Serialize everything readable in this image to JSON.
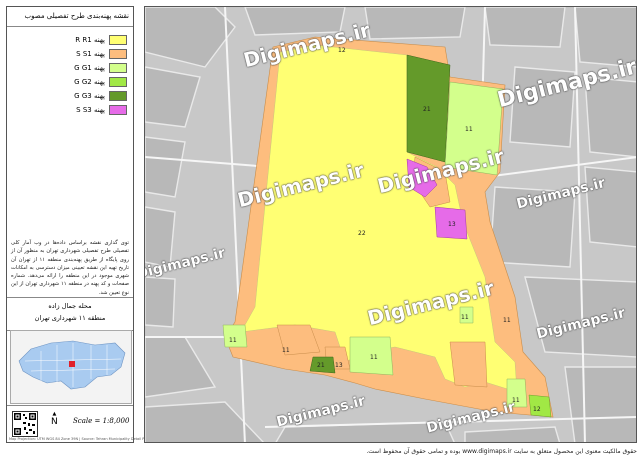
{
  "legend": {
    "title": "نقشه پهنه‌بندی طرح تفصیلی مصوب",
    "items": [
      {
        "label": "پهنه R",
        "code": "R1",
        "color": "#ffff73"
      },
      {
        "label": "پهنه S",
        "code": "S1",
        "color": "#fdbd7e"
      },
      {
        "label": "پهنه G",
        "code": "G1",
        "color": "#d3ff8c"
      },
      {
        "label": "پهنه G",
        "code": "G2",
        "color": "#a1e845"
      },
      {
        "label": "پهنه G",
        "code": "G3",
        "color": "#649a2a"
      },
      {
        "label": "پهنه S",
        "code": "S3",
        "color": "#e66be8"
      }
    ],
    "note": "توی گذاری نقشه براساس داده‌ها در وب آمار کلی تفصیلی طرح تفصیلی شهرداری تهران به منظور آن از روی پایگاه از طریق پهنه‌بندی منطقه ۱۱ از تهران آن تاریخ تهیه این نقشه تعیینی میزان دسترسی به امکانات شهری موجود در این منطقه را ارائه می‌دهد. شماره صفحات و کد پهنه در منطقه ۱۱ شهرداری تهران از این نوع تعیین شد.",
    "region_line1": "محله جمال زاده",
    "region_line2": "منطقه ۱۱ شهرداری تهران",
    "scale": "Scale = 1:8,000",
    "north": "N",
    "credit": "Map Projection: UTM WGS 84 Zone 39N | Source: Tehran Municipality Detail Plan | Prepared by Digimaps"
  },
  "map": {
    "zone_labels": [
      "12",
      "21",
      "11",
      "22",
      "13",
      "11",
      "11",
      "21",
      "13",
      "11",
      "11",
      "12",
      "11",
      "11"
    ],
    "watermarks": [
      "Digimaps.ir",
      "Digimaps.ir",
      "Digimaps.ir",
      "Digimaps.ir",
      "Digimaps.ir",
      "Digimaps.ir",
      "Digimaps.ir",
      "Digimaps.ir",
      "Digimaps.ir",
      "Digimaps.ir"
    ]
  },
  "footer": "حقوق مالکیت معنوی این محصول متعلق به سایت www.digimaps.ir بوده و تمامی حقوق آن محفوظ است."
}
